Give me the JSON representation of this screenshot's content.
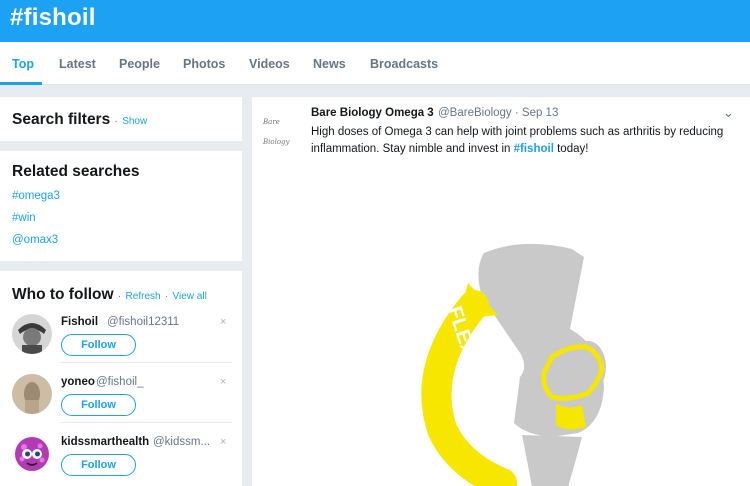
{
  "header": {
    "title": "#fishoil"
  },
  "nav": {
    "tabs": [
      {
        "label": "Top",
        "active": true
      },
      {
        "label": "Latest"
      },
      {
        "label": "People"
      },
      {
        "label": "Photos"
      },
      {
        "label": "Videos"
      },
      {
        "label": "News"
      },
      {
        "label": "Broadcasts"
      }
    ]
  },
  "search_filters": {
    "title": "Search filters",
    "separator": "·",
    "show_label": "Show"
  },
  "related": {
    "title": "Related searches",
    "items": [
      "#omega3",
      "#win",
      "@omax3"
    ]
  },
  "who_to_follow": {
    "title": "Who to follow",
    "separator": "·",
    "refresh_label": "Refresh",
    "view_all_label": "View all",
    "follow_label": "Follow",
    "dismiss_icon": "×",
    "users": [
      {
        "name": "Fishoil",
        "handle": "@fishoil12311"
      },
      {
        "name": "yoneo",
        "handle": "@fishoil_"
      },
      {
        "name": "kidssmarthealth",
        "handle": "@kidssm..."
      }
    ]
  },
  "tweet": {
    "logo_text": "Bare Biology",
    "author": "Bare Biology Omega 3",
    "handle_date": "@BareBiology · Sep 13",
    "text_before": "High doses of Omega 3 can help with joint problems such as arthritis by reducing inflammation. Stay nimble and invest in ",
    "hashtag": "#fishoil",
    "text_after": " today!",
    "chevron_icon": "⌄",
    "media_text": "FLEXIBILITY"
  },
  "colors": {
    "accent": "#1da1f2",
    "background": "#e6ecf0",
    "muted": "#657786",
    "bone": "#c9c9c9",
    "joint_yellow": "#f7e600"
  }
}
